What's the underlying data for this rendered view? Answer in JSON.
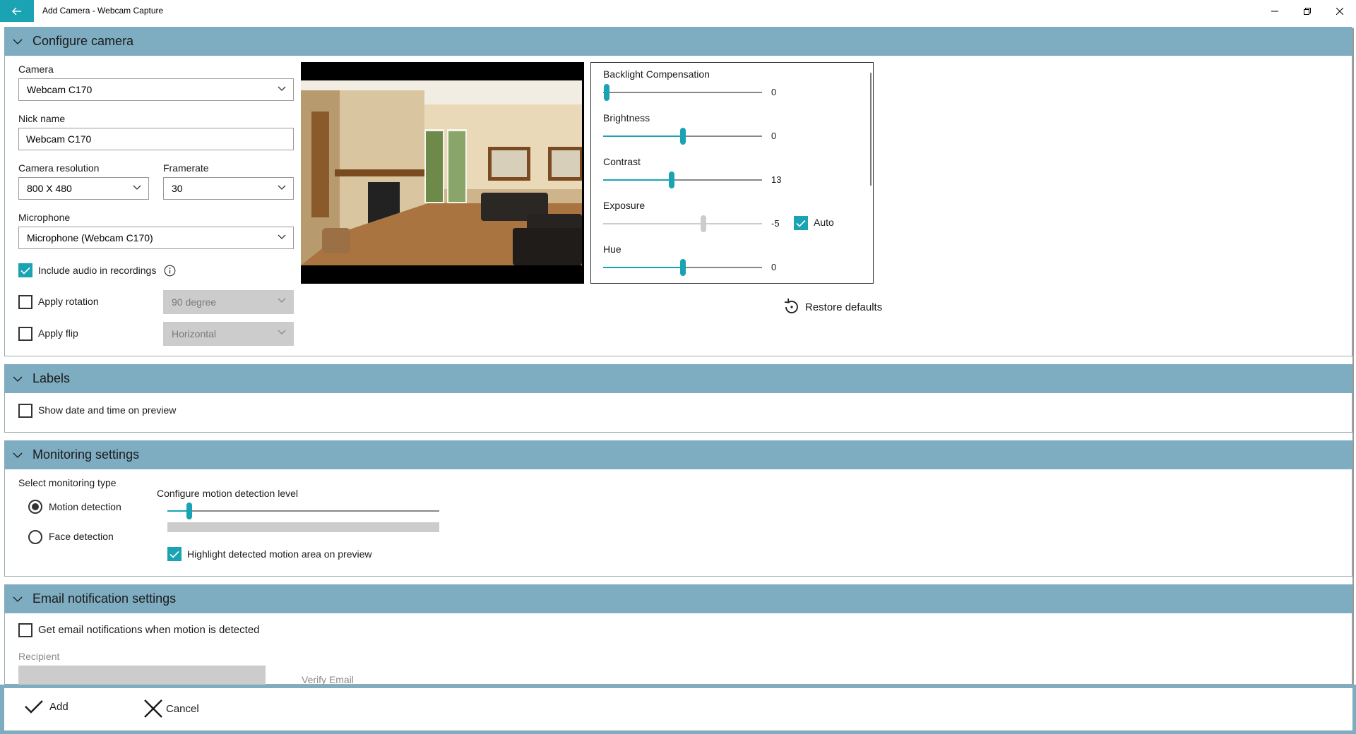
{
  "window": {
    "title": "Add Camera - Webcam Capture",
    "accent": "#1aa3b3",
    "header_color": "#7eacc0"
  },
  "configure": {
    "title": "Configure camera",
    "camera_label": "Camera",
    "camera_value": "Webcam C170",
    "nickname_label": "Nick name",
    "nickname_value": "Webcam C170",
    "resolution_label": "Camera resolution",
    "resolution_value": "800 X 480",
    "framerate_label": "Framerate",
    "framerate_value": "30",
    "microphone_label": "Microphone",
    "microphone_value": "Microphone (Webcam C170)",
    "include_audio_label": "Include audio in recordings",
    "include_audio_checked": true,
    "apply_rotation_label": "Apply rotation",
    "apply_rotation_checked": false,
    "rotation_value": "90 degree",
    "apply_flip_label": "Apply flip",
    "apply_flip_checked": false,
    "flip_value": "Horizontal",
    "properties": [
      {
        "label": "Backlight Compensation",
        "value": "0",
        "level": 0.02,
        "disabled": false
      },
      {
        "label": "Brightness",
        "value": "0",
        "level": 0.5,
        "disabled": false
      },
      {
        "label": "Contrast",
        "value": "13",
        "level": 0.43,
        "disabled": false
      },
      {
        "label": "Exposure",
        "value": "-5",
        "level": 0.63,
        "disabled": true
      },
      {
        "label": "Hue",
        "value": "0",
        "level": 0.5,
        "disabled": false
      }
    ],
    "exposure_auto_label": "Auto",
    "exposure_auto_checked": true,
    "restore_defaults_label": "Restore defaults"
  },
  "labels": {
    "title": "Labels",
    "show_datetime_label": "Show date and time on preview",
    "show_datetime_checked": false
  },
  "monitoring": {
    "title": "Monitoring settings",
    "select_type_label": "Select monitoring type",
    "motion_label": "Motion detection",
    "face_label": "Face detection",
    "selected": "motion",
    "motion_level_label": "Configure motion detection level",
    "motion_level": 0.08,
    "highlight_label": "Highlight detected motion area on preview",
    "highlight_checked": true
  },
  "email": {
    "title": "Email notification settings",
    "notify_label": "Get email notifications when motion is detected",
    "notify_checked": false,
    "recipient_label": "Recipient",
    "verify_label": "Verify Email"
  },
  "footer": {
    "add_label": "Add",
    "cancel_label": "Cancel"
  }
}
